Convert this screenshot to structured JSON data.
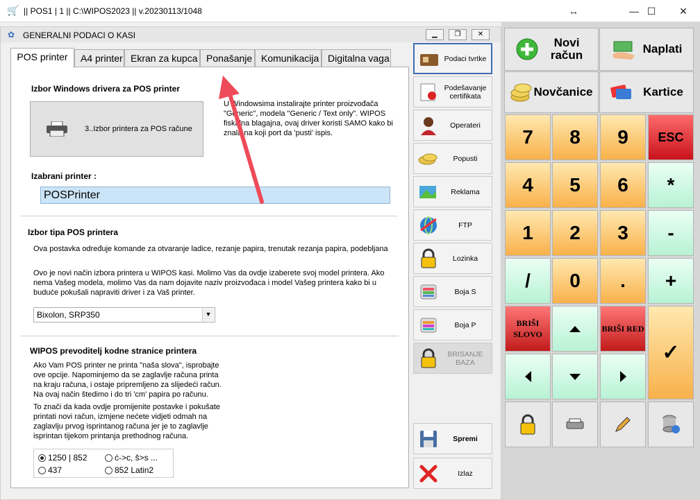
{
  "window": {
    "title": "|| POS1 | 1 || C:\\WIPOS2023 || v.20230113/1048"
  },
  "dialog": {
    "title": "GENERALNI PODACI O KASI",
    "tabs": [
      {
        "label": "POS printer",
        "active": true
      },
      {
        "label": "A4 printer"
      },
      {
        "label": "Ekran za kupca"
      },
      {
        "label": "Ponašanje"
      },
      {
        "label": "Komunikacija"
      },
      {
        "label": "Digitalna vaga"
      }
    ]
  },
  "pos_panel": {
    "driver_heading": "Izbor Windows drivera za POS printer",
    "printer_button_label": "3..Izbor printera za POS račune",
    "driver_info_1": "U Windowsima instalirajte printer proizvođača",
    "driver_info_2": "\"Generic\", modela \"Generic / Text  only\". WIPOS",
    "driver_info_3": "fiskalna blagajna, ovaj driver koristi SAMO kako bi",
    "driver_info_4": "znala na koji port da 'pusti' ispis.",
    "selected_label": "Izabrani printer :",
    "selected_value": "POSPrinter",
    "type_heading": "Izbor tipa POS printera",
    "type_info": "Ova postavka određuje komande za otvaranje ladice, rezanje papira, trenutak rezanja papira, podebljana",
    "type_info2_1": "Ovo je novi način izbora printera u WIPOS kasi. Molimo Vas da ovdje izaberete svoj model printera. Ako",
    "type_info2_2": "nema Vašeg modela, molimo Vas da nam dojavite naziv proizvođaca i model Vašeg printera kako bi u",
    "type_info2_3": "buduće pokušali napraviti driver i za Vaš printer.",
    "printer_model": "Bixolon, SRP350",
    "codepage_heading": "WIPOS prevoditelj kodne stranice printera",
    "cp1": "Ako Vam POS printer ne printa \"naša slova\", isprobajte",
    "cp2": "ove opcije. Napominjemo da se zaglavlje računa printa",
    "cp3": "na kraju računa, i ostaje pripremljeno za slijedeći račun.",
    "cp4": "Na ovaj način štedimo i do tri 'cm' papira po računu.",
    "cp5": "To znači da kada ovdje promijenite postavke i pokušate",
    "cp6": "printati novi račun, izmjene nećete vidjeti odmah na",
    "cp7": "zaglavlju prvog isprintanog računa jer je to zaglavlje",
    "cp8": "isprintan tijekom printanja prethodnog računa.",
    "radio_1252": "1250 | 852",
    "radio_conv": "ć->c, š>s ...",
    "radio_437": "437",
    "radio_852": "852 Latin2"
  },
  "side_buttons": [
    {
      "label": "Podaci tvrtke"
    },
    {
      "label": "Podešavanje certifikata"
    },
    {
      "label": "Operateri"
    },
    {
      "label": "Popusti"
    },
    {
      "label": "Reklama"
    },
    {
      "label": "FTP"
    },
    {
      "label": "Lozinka"
    },
    {
      "label": "Boja S"
    },
    {
      "label": "Boja P"
    },
    {
      "label": "BRISANJE BAZA"
    },
    {
      "label": "Spremi"
    },
    {
      "label": "Izlaz"
    }
  ],
  "keypad": {
    "novi_racun": "Novi račun",
    "naplati": "Naplati",
    "novcanice": "Novčanice",
    "kartice": "Kartice",
    "k7": "7",
    "k8": "8",
    "k9": "9",
    "esc": "ESC",
    "k4": "4",
    "k5": "5",
    "k6": "6",
    "mul": "*",
    "k1": "1",
    "k2": "2",
    "k3": "3",
    "minus": "-",
    "div": "/",
    "k0": "0",
    "dot": ".",
    "plus": "+",
    "brisi_slovo": "BRIŠI SLOVO",
    "brisi_red": "BRIŠI RED",
    "check": "✓"
  }
}
